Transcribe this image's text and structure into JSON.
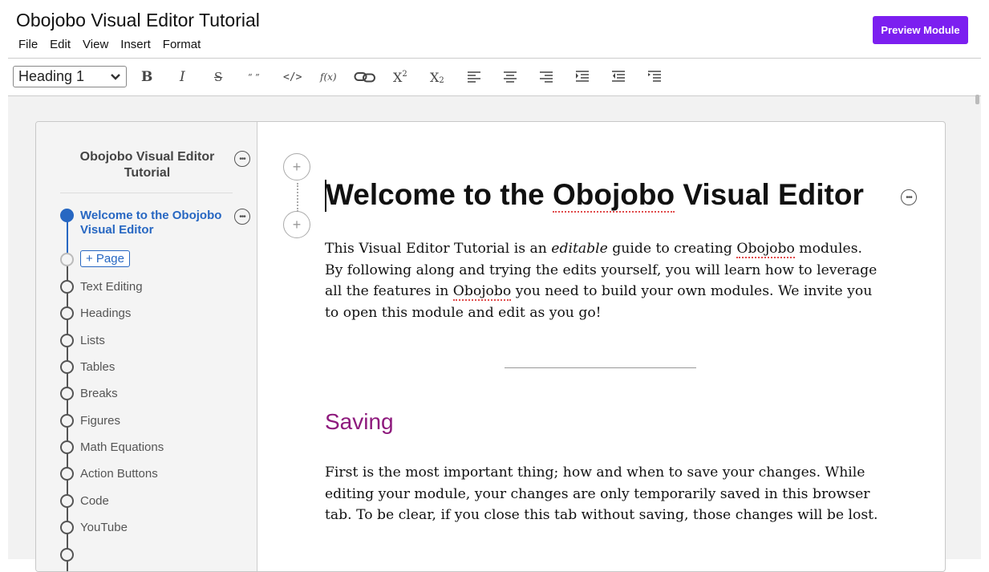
{
  "app": {
    "title": "Obojobo Visual Editor Tutorial",
    "menu": [
      "File",
      "Edit",
      "View",
      "Insert",
      "Format"
    ],
    "preview_label": "Preview Module",
    "accent_color": "#7c1ff0"
  },
  "toolbar": {
    "style_select_value": "Heading 1",
    "buttons": [
      {
        "name": "bold-icon",
        "glyph": "B"
      },
      {
        "name": "italic-icon",
        "glyph": "I"
      },
      {
        "name": "strikethrough-icon",
        "glyph": "S"
      },
      {
        "name": "quote-icon",
        "glyph": "“ ”"
      },
      {
        "name": "code-icon",
        "glyph": "</>"
      },
      {
        "name": "math-icon",
        "glyph": "f(x)"
      },
      {
        "name": "link-icon",
        "glyph": "link"
      },
      {
        "name": "superscript-icon",
        "glyph": "X2"
      },
      {
        "name": "subscript-icon",
        "glyph": "X2"
      },
      {
        "name": "align-left-icon",
        "glyph": "left"
      },
      {
        "name": "align-center-icon",
        "glyph": "center"
      },
      {
        "name": "align-right-icon",
        "glyph": "right"
      },
      {
        "name": "indent-icon",
        "glyph": "indent"
      },
      {
        "name": "outdent-icon",
        "glyph": "outdent"
      },
      {
        "name": "hanging-indent-icon",
        "glyph": "hanging"
      }
    ]
  },
  "sidebar": {
    "module_title": "Obojobo Visual Editor Tutorial",
    "active_item": "Welcome to the Obojobo Visual Editor",
    "add_page_label": "+ Page",
    "items": [
      "Text Editing",
      "Headings",
      "Lists",
      "Tables",
      "Breaks",
      "Figures",
      "Math Equations",
      "Action Buttons",
      "Code",
      "YouTube"
    ],
    "active_color": "#2767c2"
  },
  "content": {
    "heading_prefix": "Welcome to the ",
    "heading_misspelled": "Obojobo",
    "heading_suffix": " Visual Editor",
    "intro_1": "This Visual Editor Tutorial is an ",
    "intro_em": "editable",
    "intro_2": " guide to creating ",
    "intro_misspelled_1": "Obojobo",
    "intro_3": " modules. By following along and trying the edits yourself, you will learn how to leverage all the features in ",
    "intro_misspelled_2": "Obojobo",
    "intro_4": " you need to build your own modules. We invite you to open this module and edit as you go!",
    "section_heading": "Saving",
    "section_heading_color": "#8e1a7d",
    "saving_paragraph": "First is the most important thing; how and when to save your changes. While editing your module, your changes are only temporarily saved in this browser tab. To be clear, if you close this tab without saving, those changes will be lost."
  }
}
